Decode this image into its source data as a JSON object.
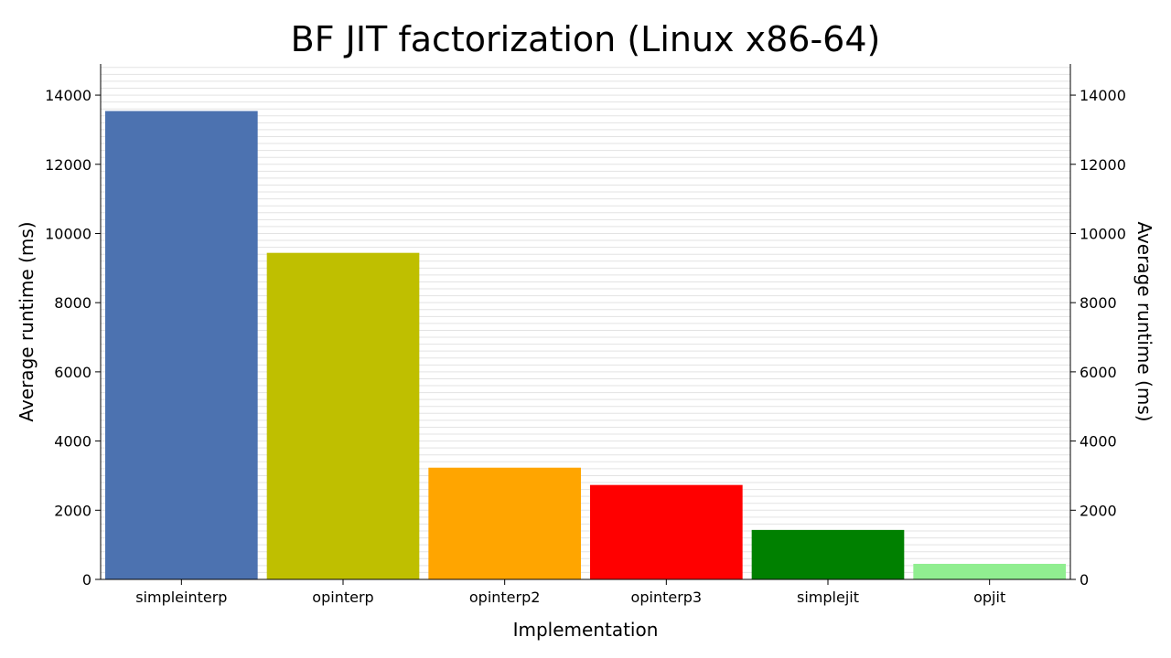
{
  "chart_data": {
    "type": "bar",
    "title": "BF JIT factorization (Linux x86-64)",
    "xlabel": "Implementation",
    "ylabel": "Average runtime (ms)",
    "ylabel_right": "Average runtime (ms)",
    "categories": [
      "simpleinterp",
      "opinterp",
      "opinterp2",
      "opinterp3",
      "simplejit",
      "opjit"
    ],
    "values": [
      13540,
      9440,
      3230,
      2730,
      1430,
      450
    ],
    "colors": [
      "#4c72b0",
      "#bfbf00",
      "#ffa500",
      "#ff0000",
      "#008000",
      "#90ee90"
    ],
    "ylim": [
      0,
      14900
    ],
    "yticks": [
      0,
      2000,
      4000,
      6000,
      8000,
      10000,
      12000,
      14000
    ],
    "minor_grid_step": 200,
    "grid": true,
    "legend": "none"
  }
}
